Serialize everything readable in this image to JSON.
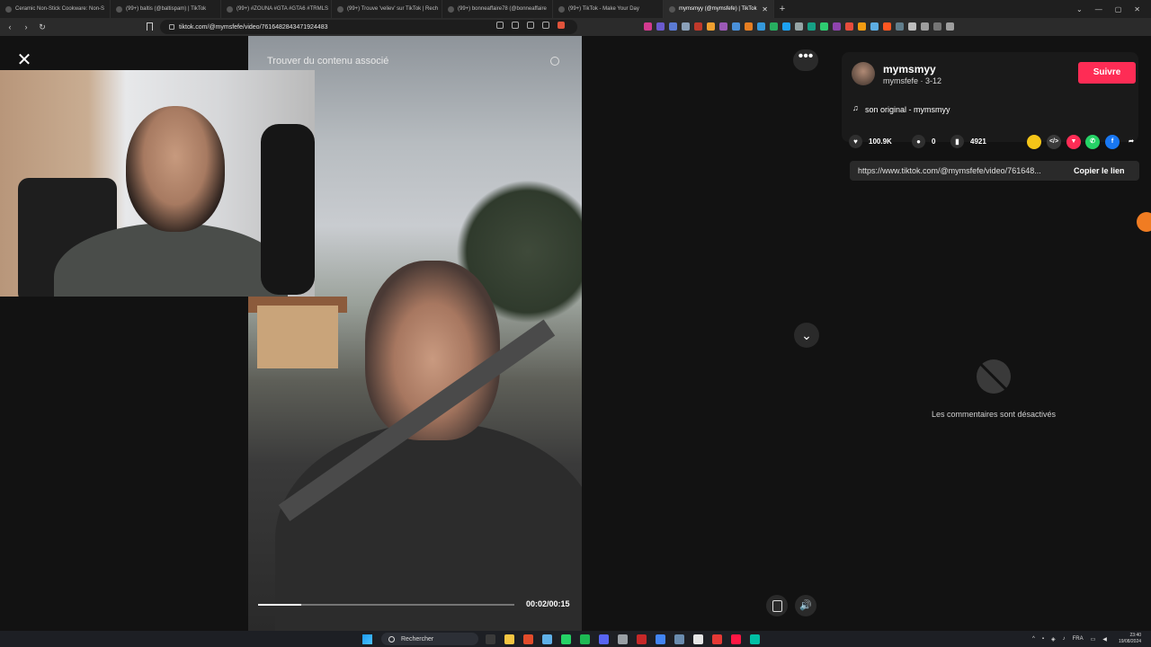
{
  "browser": {
    "tabs": [
      {
        "label": "Ceramic Non-Stick Cookware: Non-S",
        "active": false
      },
      {
        "label": "(99+) baltis (@baltispam) | TikTok",
        "active": false
      },
      {
        "label": "(99+) #ZOUNA #GTA #GTA6 #TRMLS",
        "active": false
      },
      {
        "label": "(99+) Trouve 'veliev' sur TikTok | Rech",
        "active": false
      },
      {
        "label": "(99+) bonneaffaire78 (@bonneaffaire",
        "active": false
      },
      {
        "label": "(99+) TikTok - Make Your Day",
        "active": false
      },
      {
        "label": "mymsmyy (@mymsfefe) | TikTok",
        "active": true
      }
    ],
    "url": "tiktok.com/@mymsfefe/video/7616482843471924483"
  },
  "video": {
    "search_placeholder": "Trouver du contenu associé",
    "time": "00:02/00:15",
    "progress": 0.17
  },
  "author": {
    "name": "mymsmyy",
    "handle_date": "mymsfefe · 3-12",
    "follow_label": "Suivre",
    "music": "son original - mymsmyy"
  },
  "stats": {
    "likes": "100.9K",
    "comments": "0",
    "saves": "4921"
  },
  "share": {
    "colors": [
      "#f5c518",
      "#3a3a3a",
      "#fe2c55",
      "#25d366",
      "#1877f2"
    ]
  },
  "link": {
    "url": "https://www.tiktok.com/@mymsfefe/video/761648...",
    "copy_label": "Copier le lien"
  },
  "comments": {
    "disabled_text": "Les commentaires sont désactivés"
  },
  "taskbar": {
    "search_label": "Rechercher",
    "lang": "FRA",
    "time": "23:40",
    "date": "19/08/2024"
  },
  "colors": {
    "accent": "#fe2c55",
    "background": "#121212"
  }
}
